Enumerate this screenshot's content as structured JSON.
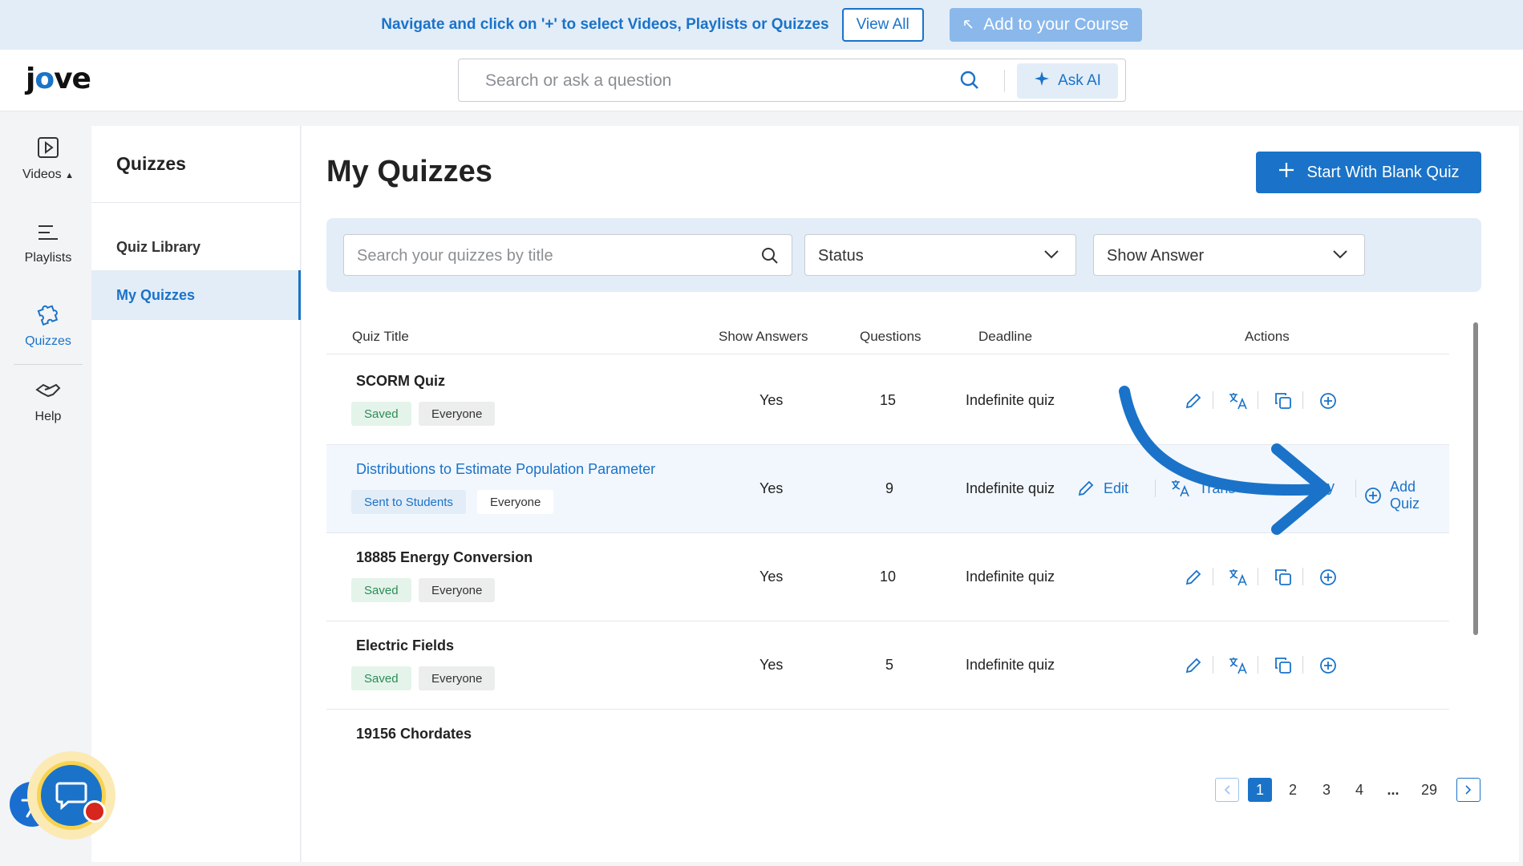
{
  "banner": {
    "text": "Navigate and click on '+' to select Videos, Playlists or Quizzes",
    "view_all": "View All",
    "add_course": "Add to your Course"
  },
  "header": {
    "logo_pre": "j",
    "logo_o": "o",
    "logo_post": "ve",
    "search_placeholder": "Search or ask a question",
    "ask_ai": "Ask AI"
  },
  "rail": {
    "videos": "Videos",
    "playlists": "Playlists",
    "quizzes": "Quizzes",
    "help": "Help"
  },
  "subnav": {
    "title": "Quizzes",
    "items": [
      "Quiz Library",
      "My Quizzes"
    ]
  },
  "main": {
    "title": "My Quizzes",
    "blank_quiz": "Start With Blank Quiz",
    "search_placeholder": "Search your quizzes by title",
    "status": "Status",
    "show_answer": "Show Answer"
  },
  "table": {
    "headers": [
      "Quiz Title",
      "Show Answers",
      "Questions",
      "Deadline",
      "Actions"
    ],
    "rows": [
      {
        "title": "SCORM Quiz",
        "status": "Saved",
        "audience": "Everyone",
        "show_answers": "Yes",
        "questions": "15",
        "deadline": "Indefinite quiz"
      },
      {
        "title": "Distributions to Estimate Population Parameter",
        "status": "Sent to Students",
        "audience": "Everyone",
        "show_answers": "Yes",
        "questions": "9",
        "deadline": "Indefinite quiz"
      },
      {
        "title": "18885 Energy Conversion",
        "status": "Saved",
        "audience": "Everyone",
        "show_answers": "Yes",
        "questions": "10",
        "deadline": "Indefinite quiz"
      },
      {
        "title": "Electric Fields",
        "status": "Saved",
        "audience": "Everyone",
        "show_answers": "Yes",
        "questions": "5",
        "deadline": "Indefinite quiz"
      },
      {
        "title": "19156 Chordates",
        "status": "",
        "audience": "",
        "show_answers": "",
        "questions": "",
        "deadline": ""
      }
    ],
    "action_labels": {
      "edit": "Edit",
      "translate": "Trans",
      "copy": "py",
      "add": "Add Quiz"
    }
  },
  "pagination": {
    "pages": [
      "1",
      "2",
      "3",
      "4",
      "...",
      "29"
    ],
    "current": "1"
  },
  "colors": {
    "accent": "#1a73c8",
    "banner_bg": "#e3edf8",
    "saved_text": "#2e8b57"
  }
}
